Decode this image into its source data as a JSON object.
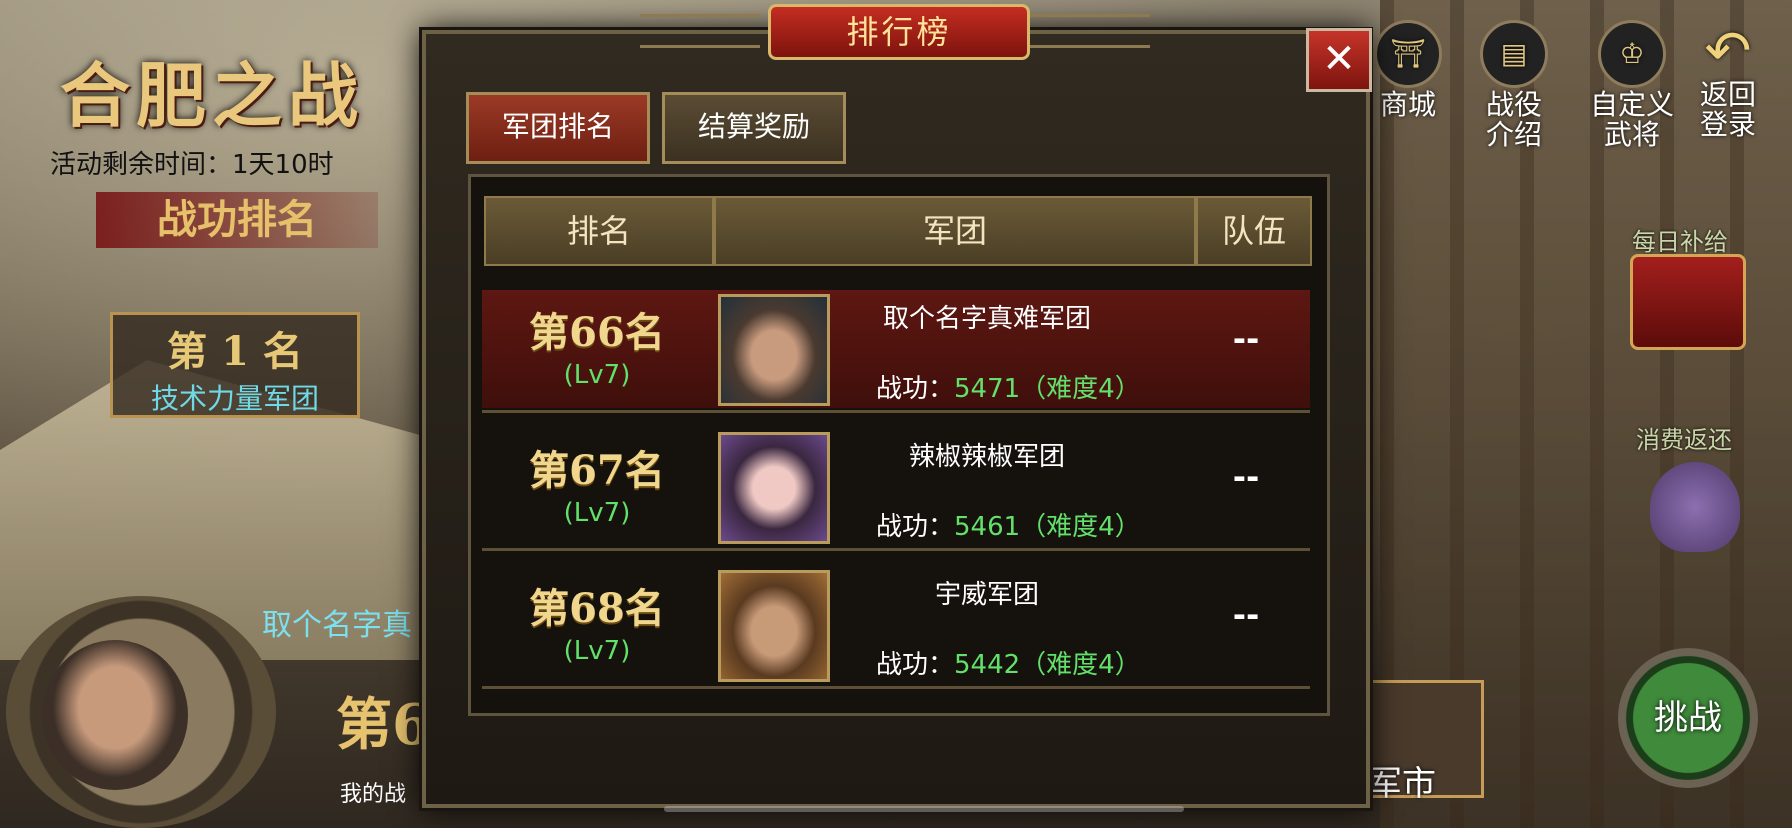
{
  "event": {
    "title": "合肥之战",
    "remaining": "活动剩余时间：1天10时",
    "rank_banner": "战功排名",
    "first_place": {
      "label": "第 1 名",
      "team": "技术力量军团"
    },
    "my_team": "取个名字真",
    "my_rank": "第6",
    "my_gong": "我的战"
  },
  "hud": {
    "shop": "商城",
    "battle_intro": [
      "战役",
      "介绍"
    ],
    "custom_general": [
      "自定义",
      "武将"
    ],
    "return_login": [
      "返回",
      "登录"
    ],
    "daily_supply": "每日补给",
    "consume_rebate": "消费返还",
    "market": "军市",
    "challenge": "挑战"
  },
  "modal": {
    "title": "排行榜",
    "close": "✕",
    "tabs": [
      {
        "label": "军团排名",
        "active": true
      },
      {
        "label": "结算奖励",
        "active": false
      }
    ],
    "columns": [
      "排名",
      "军团",
      "队伍"
    ],
    "rows": [
      {
        "rank": "第66名",
        "level": "(Lv7)",
        "team": "取个名字真难军团",
        "gong_label": "战功：",
        "gong_value": "5471（难度4）",
        "squad": "--",
        "selected": true
      },
      {
        "rank": "第67名",
        "level": "(Lv7)",
        "team": "辣椒辣椒军团",
        "gong_label": "战功：",
        "gong_value": "5461（难度4）",
        "squad": "--",
        "selected": false
      },
      {
        "rank": "第68名",
        "level": "(Lv7)",
        "team": "宇威军团",
        "gong_label": "战功：",
        "gong_value": "5442（难度4）",
        "squad": "--",
        "selected": false
      }
    ]
  }
}
